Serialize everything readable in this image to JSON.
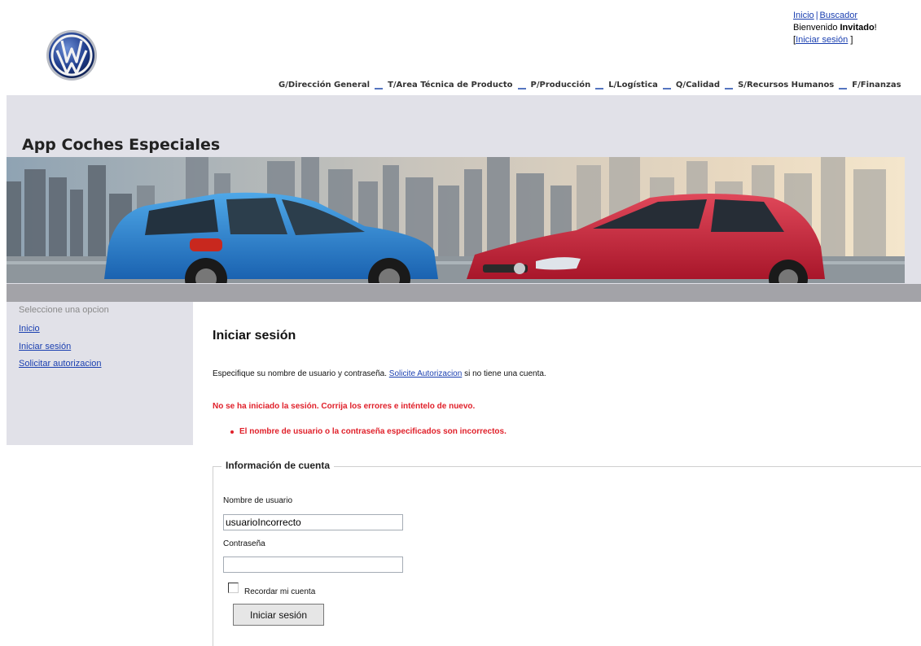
{
  "top_links": {
    "home": "Inicio",
    "separator": "|",
    "search": "Buscador",
    "welcome_prefix": "Bienvenido ",
    "user": "Invitado",
    "welcome_suffix": "!",
    "login_open": "[",
    "login": "Iniciar sesión",
    "login_close": " ]"
  },
  "nav": [
    "G/Dirección General",
    "T/Area Técnica de Producto",
    "P/Producción",
    "L/Logística",
    "Q/Calidad",
    "S/Recursos Humanos",
    "F/Finanzas"
  ],
  "app_title": "App Coches Especiales",
  "sidebar": {
    "heading": "Seleccione una opcion",
    "items": [
      "Inicio",
      "Iniciar sesión",
      "Solicitar autorizacion"
    ]
  },
  "main": {
    "title": "Iniciar sesión",
    "intro_before": "Especifique su nombre de usuario y contraseña. ",
    "intro_link": "Solicite Autorizacion",
    "intro_after": " si no tiene una cuenta.",
    "error_summary": "No se ha iniciado la sesión. Corrija los errores e inténtelo de nuevo.",
    "error_item": "El nombre de usuario o la contraseña especificados son incorrectos.",
    "fieldset_legend": "Información de cuenta",
    "username_label": "Nombre de usuario",
    "username_value": "usuarioIncorrecto",
    "password_label": "Contraseña",
    "password_value": "",
    "remember_label": "Recordar mi cuenta",
    "remember_checked": false,
    "submit_label": "Iniciar sesión"
  },
  "colors": {
    "error": "#e0202a",
    "link": "#1a3fb0",
    "band": "#e1e1e8",
    "strip": "#a3a3a8"
  }
}
